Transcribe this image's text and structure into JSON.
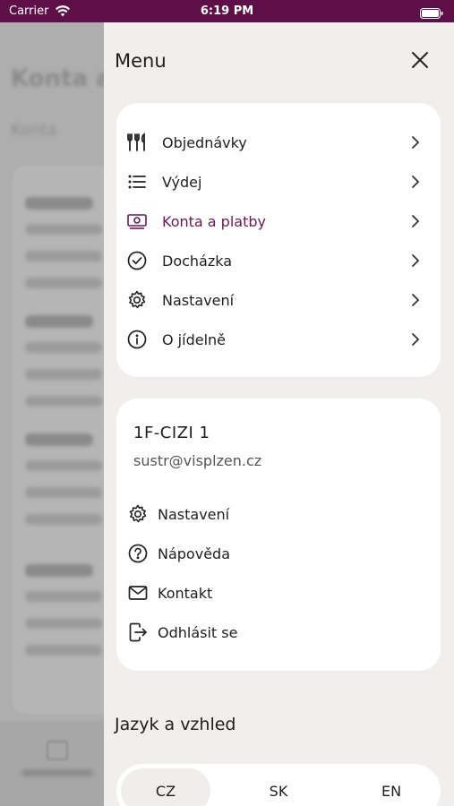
{
  "status_bar": {
    "carrier": "Carrier",
    "time": "6:19 PM"
  },
  "background_page": {
    "title": "Konta a",
    "subtitle": "Konta"
  },
  "drawer": {
    "title": "Menu",
    "menu_items": [
      {
        "label": "Objednávky",
        "icon": "cutlery-icon",
        "active": false
      },
      {
        "label": "Výdej",
        "icon": "list-icon",
        "active": false
      },
      {
        "label": "Konta a platby",
        "icon": "money-icon",
        "active": true
      },
      {
        "label": "Docházka",
        "icon": "check-circle-icon",
        "active": false
      },
      {
        "label": "Nastavení",
        "icon": "gear-icon",
        "active": false
      },
      {
        "label": "O jídelně",
        "icon": "info-icon",
        "active": false
      }
    ],
    "user": {
      "name": "1F-CIZI 1",
      "email": "sustr@visplzen.cz",
      "items": [
        {
          "label": "Nastavení",
          "icon": "gear-icon"
        },
        {
          "label": "Nápověda",
          "icon": "help-icon"
        },
        {
          "label": "Kontakt",
          "icon": "mail-icon"
        },
        {
          "label": "Odhlásit se",
          "icon": "logout-icon"
        }
      ]
    },
    "language_section_title": "Jazyk a vzhled",
    "languages": [
      {
        "label": "CZ",
        "selected": true
      },
      {
        "label": "SK",
        "selected": false
      },
      {
        "label": "EN",
        "selected": false
      }
    ]
  },
  "colors": {
    "status_bar": "#5e0f48",
    "accent": "#6c1656",
    "drawer_bg": "#f1efee",
    "card_bg": "#ffffff"
  }
}
